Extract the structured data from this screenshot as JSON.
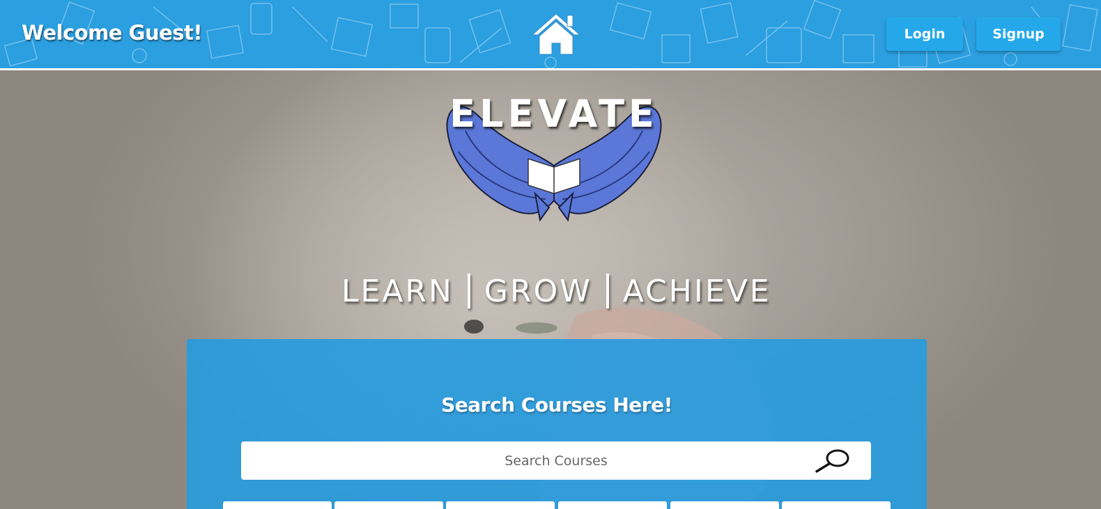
{
  "header": {
    "welcome_text": "Welcome Guest!",
    "home_icon": "home-icon",
    "login_label": "Login",
    "signup_label": "Signup",
    "background_color": "#2b9fe0"
  },
  "hero": {
    "logo_text": "ELEVATE",
    "logo_icon": "winged-book-logo",
    "tagline": [
      "LEARN",
      "GROW",
      "ACHIEVE"
    ]
  },
  "search": {
    "title": "Search Courses Here!",
    "placeholder": "Search Courses",
    "search_icon": "magnifier-icon",
    "panel_color": "#299bde"
  }
}
